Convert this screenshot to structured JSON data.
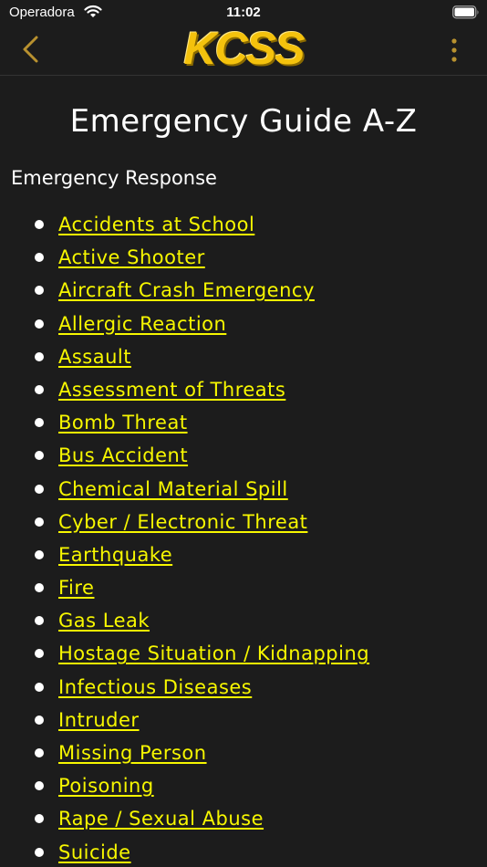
{
  "status_bar": {
    "carrier": "Operadora",
    "time": "11:02"
  },
  "nav": {
    "logo_text": "KCSS",
    "icons": {
      "back": "chevron-left-icon",
      "menu": "more-vertical-icon"
    }
  },
  "content": {
    "title": "Emergency Guide A-Z",
    "section_heading": "Emergency Response",
    "items": [
      "Accidents at School",
      "Active Shooter",
      "Aircraft Crash Emergency",
      "Allergic Reaction",
      "Assault",
      "Assessment of Threats",
      "Bomb Threat",
      "Bus Accident",
      "Chemical Material Spill",
      "Cyber / Electronic Threat",
      "Earthquake",
      "Fire",
      "Gas Leak",
      "Hostage Situation / Kidnapping",
      "Infectious Diseases",
      "Intruder",
      "Missing Person",
      "Poisoning",
      "Rape / Sexual Abuse",
      "Suicide"
    ]
  },
  "colors": {
    "background": "#1c1c1c",
    "link": "#f7f700",
    "logo": "#f4c20d",
    "nav_icons": "#b8912f"
  }
}
